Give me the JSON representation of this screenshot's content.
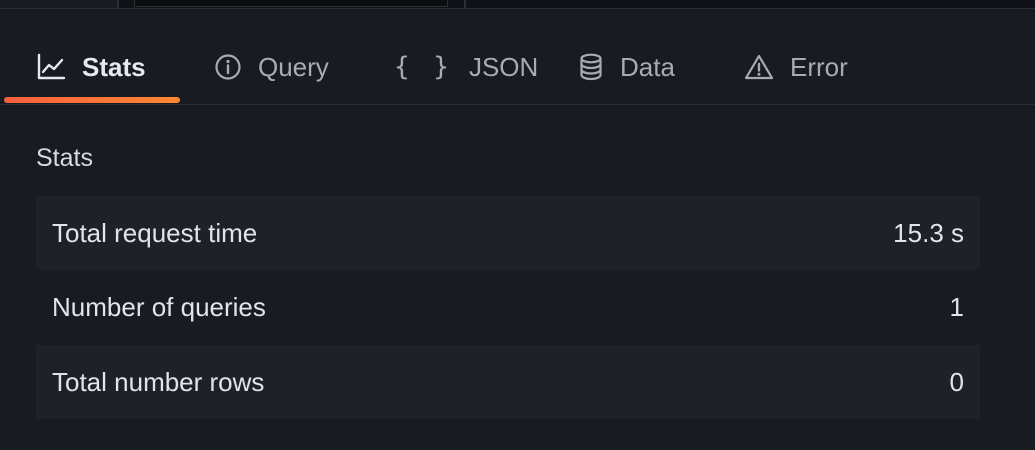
{
  "tabs": [
    {
      "label": "Stats",
      "icon": "chart-line-icon",
      "active": true
    },
    {
      "label": "Query",
      "icon": "info-circle-icon",
      "active": false
    },
    {
      "label": "JSON",
      "icon": "braces-icon",
      "active": false
    },
    {
      "label": "Data",
      "icon": "database-icon",
      "active": false
    },
    {
      "label": "Error",
      "icon": "warning-triangle-icon",
      "active": false
    }
  ],
  "stats": {
    "title": "Stats",
    "rows": [
      {
        "label": "Total request time",
        "value": "15.3 s"
      },
      {
        "label": "Number of queries",
        "value": "1"
      },
      {
        "label": "Total number rows",
        "value": "0"
      }
    ]
  },
  "colors": {
    "background": "#181b1f",
    "active_underline_start": "#f55f3e",
    "active_underline_end": "#ff8833",
    "row_shade": "#1f2126"
  }
}
